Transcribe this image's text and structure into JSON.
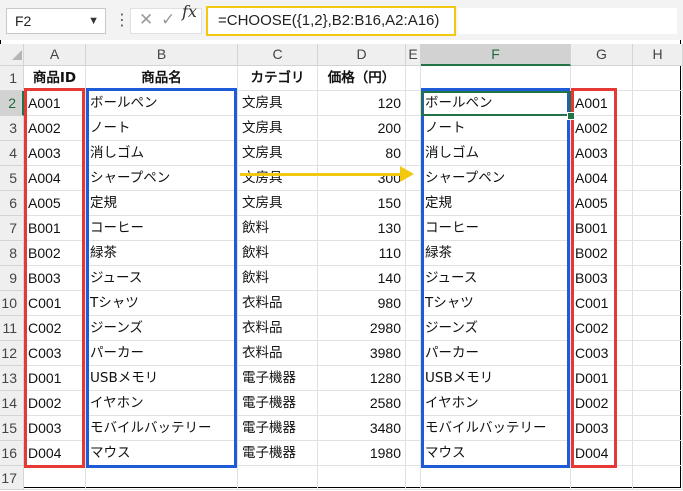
{
  "formula_bar": {
    "name_box": "F2",
    "formula": "=CHOOSE({1,2},B2:B16,A2:A16)",
    "fx_label": "fx",
    "cancel_glyph": "✕",
    "enter_glyph": "✓",
    "dots": "⋮"
  },
  "columns": [
    "A",
    "B",
    "C",
    "D",
    "E",
    "F",
    "G",
    "H"
  ],
  "header_row": {
    "A": "商品ID",
    "B": "商品名",
    "C": "カテゴリ",
    "D": "価格（円）"
  },
  "rows": [
    {
      "id": "A001",
      "name": "ボールペン",
      "category": "文房具",
      "price": "120"
    },
    {
      "id": "A002",
      "name": "ノート",
      "category": "文房具",
      "price": "200"
    },
    {
      "id": "A003",
      "name": "消しゴム",
      "category": "文房具",
      "price": "80"
    },
    {
      "id": "A004",
      "name": "シャープペン",
      "category": "文房具",
      "price": "300"
    },
    {
      "id": "A005",
      "name": "定規",
      "category": "文房具",
      "price": "150"
    },
    {
      "id": "B001",
      "name": "コーヒー",
      "category": "飲料",
      "price": "130"
    },
    {
      "id": "B002",
      "name": "緑茶",
      "category": "飲料",
      "price": "110"
    },
    {
      "id": "B003",
      "name": "ジュース",
      "category": "飲料",
      "price": "140"
    },
    {
      "id": "C001",
      "name": "Tシャツ",
      "category": "衣料品",
      "price": "980"
    },
    {
      "id": "C002",
      "name": "ジーンズ",
      "category": "衣料品",
      "price": "2980"
    },
    {
      "id": "C003",
      "name": "パーカー",
      "category": "衣料品",
      "price": "3980"
    },
    {
      "id": "D001",
      "name": "USBメモリ",
      "category": "電子機器",
      "price": "1280"
    },
    {
      "id": "D002",
      "name": "イヤホン",
      "category": "電子機器",
      "price": "2580"
    },
    {
      "id": "D003",
      "name": "モバイルバッテリー",
      "category": "電子機器",
      "price": "3480"
    },
    {
      "id": "D004",
      "name": "マウス",
      "category": "電子機器",
      "price": "1980"
    }
  ],
  "colors": {
    "id_highlight": "#e53935",
    "name_highlight": "#1e5bd8",
    "formula_highlight": "#f2c811",
    "active_cell": "#217346"
  }
}
